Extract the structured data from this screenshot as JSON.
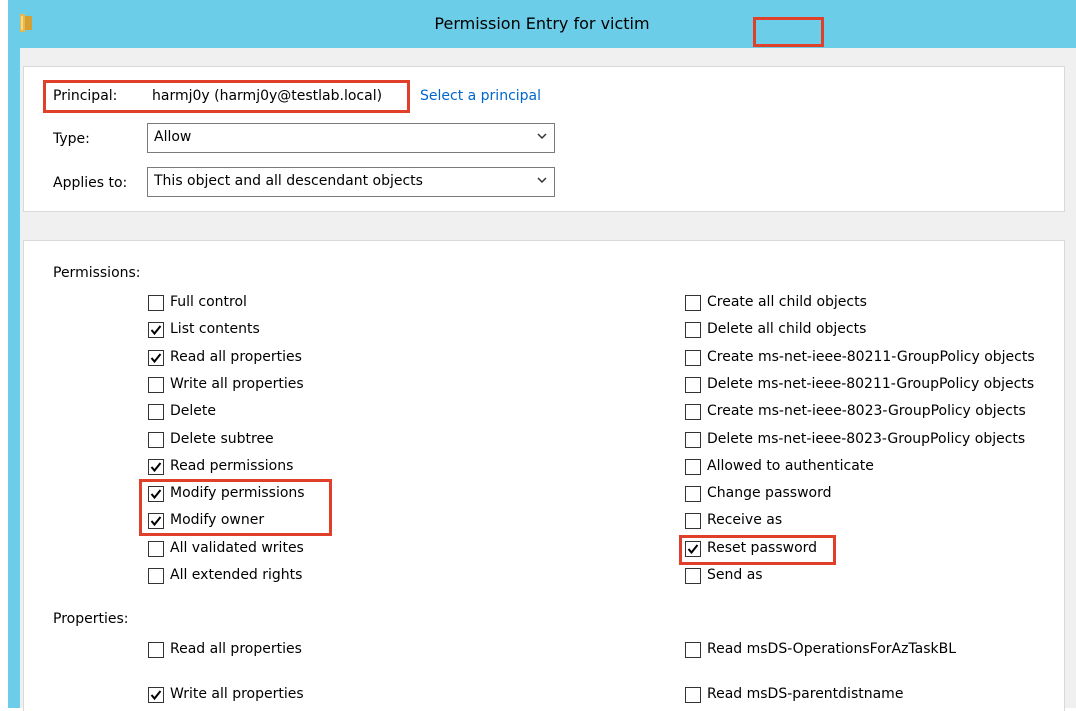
{
  "window": {
    "title_prefix": "Permission Entry for",
    "title_object": "victim"
  },
  "principal": {
    "label": "Principal:",
    "value": "harmj0y (harmj0y@testlab.local)",
    "link": "Select a principal"
  },
  "type": {
    "label": "Type:",
    "value": "Allow"
  },
  "applies_to": {
    "label": "Applies to:",
    "value": "This object and all descendant objects"
  },
  "permissions": {
    "label": "Permissions:",
    "left": [
      {
        "label": "Full control",
        "checked": false
      },
      {
        "label": "List contents",
        "checked": true
      },
      {
        "label": "Read all properties",
        "checked": true
      },
      {
        "label": "Write all properties",
        "checked": false
      },
      {
        "label": "Delete",
        "checked": false
      },
      {
        "label": "Delete subtree",
        "checked": false
      },
      {
        "label": "Read permissions",
        "checked": true
      },
      {
        "label": "Modify permissions",
        "checked": true
      },
      {
        "label": "Modify owner",
        "checked": true
      },
      {
        "label": "All validated writes",
        "checked": false
      },
      {
        "label": "All extended rights",
        "checked": false
      }
    ],
    "right": [
      {
        "label": "Create all child objects",
        "checked": false
      },
      {
        "label": "Delete all child objects",
        "checked": false
      },
      {
        "label": "Create ms-net-ieee-80211-GroupPolicy objects",
        "checked": false
      },
      {
        "label": "Delete ms-net-ieee-80211-GroupPolicy objects",
        "checked": false
      },
      {
        "label": "Create ms-net-ieee-8023-GroupPolicy objects",
        "checked": false
      },
      {
        "label": "Delete ms-net-ieee-8023-GroupPolicy objects",
        "checked": false
      },
      {
        "label": "Allowed to authenticate",
        "checked": false
      },
      {
        "label": "Change password",
        "checked": false
      },
      {
        "label": "Receive as",
        "checked": false
      },
      {
        "label": "Reset password",
        "checked": true
      },
      {
        "label": "Send as",
        "checked": false
      }
    ]
  },
  "properties": {
    "label": "Properties:",
    "left": [
      {
        "label": "Read all properties",
        "checked": false
      },
      {
        "label": "Write all properties",
        "checked": true
      }
    ],
    "right": [
      {
        "label": "Read msDS-OperationsForAzTaskBL",
        "checked": false
      },
      {
        "label": "Read msDS-parentdistname",
        "checked": false
      }
    ]
  },
  "colors": {
    "titlebar": "#6ccde9",
    "highlight": "#e0402a",
    "link": "#0066cc"
  }
}
